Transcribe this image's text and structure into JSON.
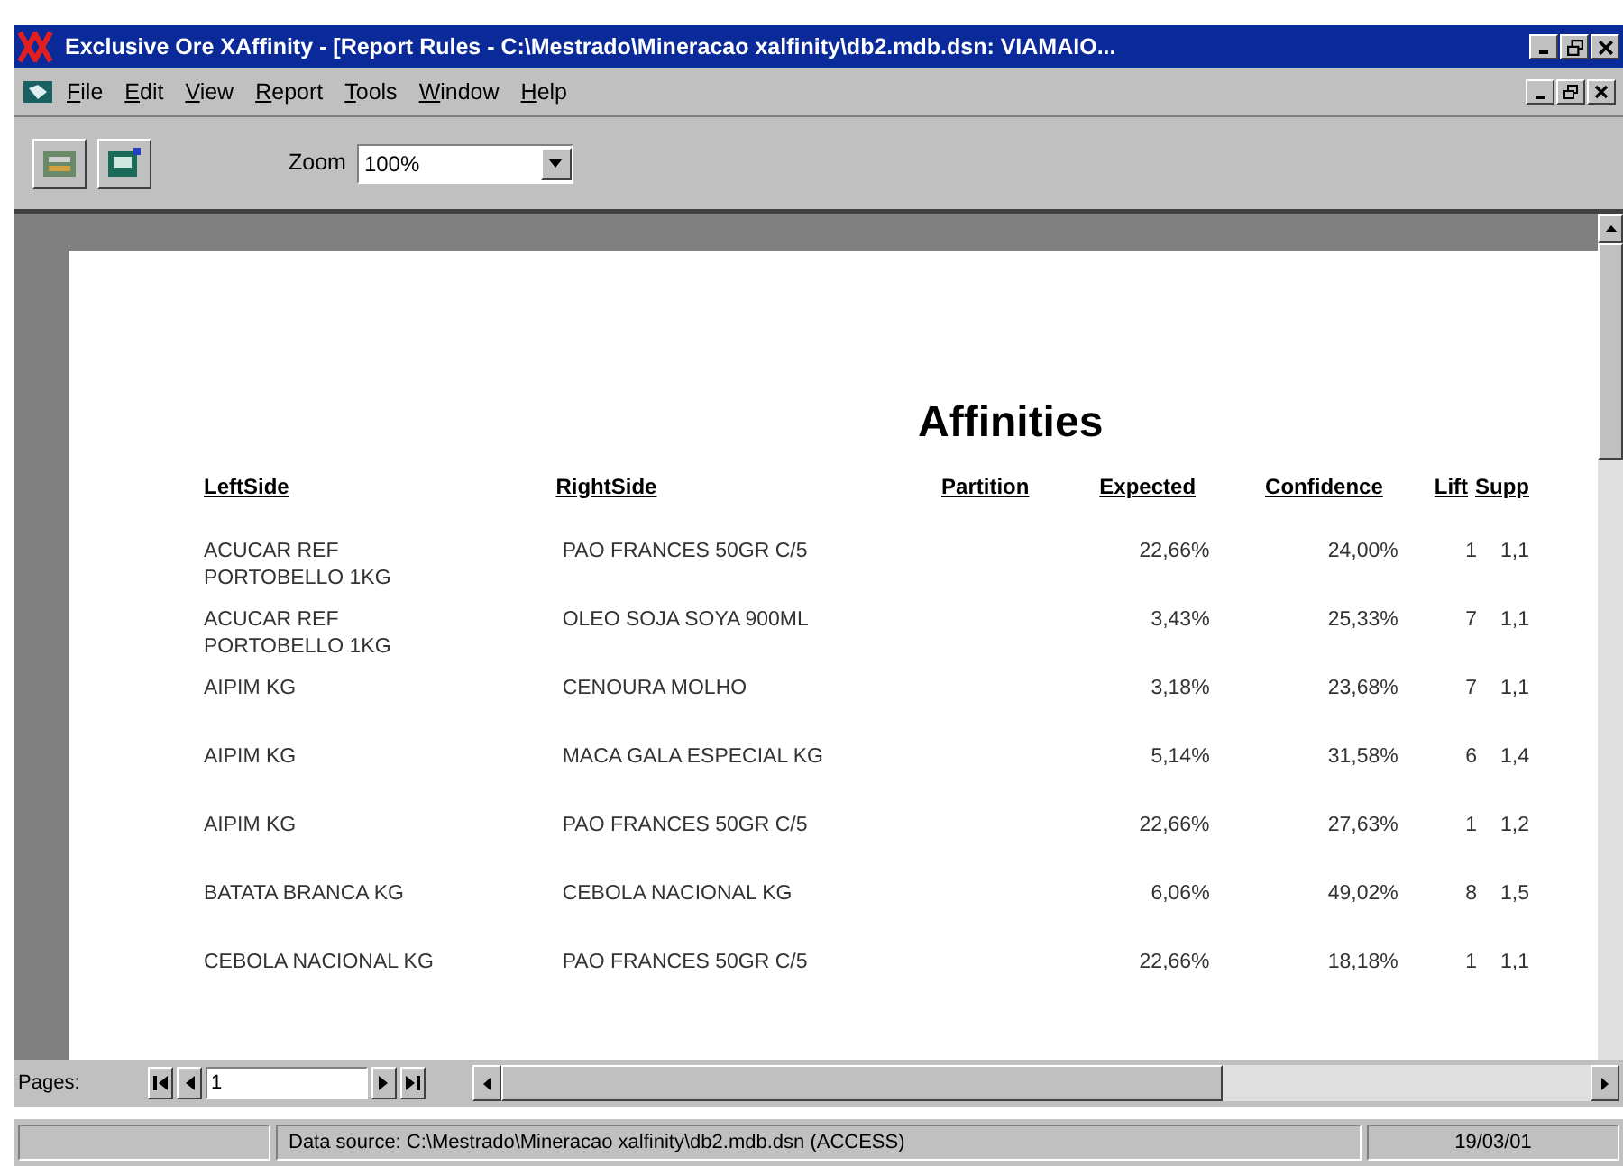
{
  "window": {
    "title": "Exclusive Ore XAffinity - [Report Rules - C:\\Mestrado\\Mineracao xalfinity\\db2.mdb.dsn: VIAMAIO..."
  },
  "menu": [
    {
      "mnemonic": "F",
      "rest": "ile"
    },
    {
      "mnemonic": "E",
      "rest": "dit"
    },
    {
      "mnemonic": "V",
      "rest": "iew"
    },
    {
      "mnemonic": "R",
      "rest": "eport"
    },
    {
      "mnemonic": "T",
      "rest": "ools"
    },
    {
      "mnemonic": "W",
      "rest": "indow"
    },
    {
      "mnemonic": "H",
      "rest": "elp"
    }
  ],
  "toolbar": {
    "zoom_label": "Zoom",
    "zoom_value": "100%"
  },
  "report": {
    "title": "Affinities",
    "columns": [
      "LeftSide",
      "RightSide",
      "Partition",
      "Expected",
      "Confidence",
      "Lift",
      "Supp"
    ],
    "rows": [
      {
        "left": "ACUCAR REF PORTOBELLO 1KG",
        "right": "PAO FRANCES 50GR C/5",
        "expected": "22,66%",
        "confidence": "24,00%",
        "lift": "1",
        "support": "1,1"
      },
      {
        "left": "ACUCAR REF PORTOBELLO 1KG",
        "right": "OLEO SOJA SOYA 900ML",
        "expected": "3,43%",
        "confidence": "25,33%",
        "lift": "7",
        "support": "1,1"
      },
      {
        "left": "AIPIM KG",
        "right": "CENOURA MOLHO",
        "expected": "3,18%",
        "confidence": "23,68%",
        "lift": "7",
        "support": "1,1"
      },
      {
        "left": "AIPIM KG",
        "right": "MACA GALA ESPECIAL KG",
        "expected": "5,14%",
        "confidence": "31,58%",
        "lift": "6",
        "support": "1,4"
      },
      {
        "left": "AIPIM KG",
        "right": "PAO FRANCES 50GR C/5",
        "expected": "22,66%",
        "confidence": "27,63%",
        "lift": "1",
        "support": "1,2"
      },
      {
        "left": "BATATA BRANCA KG",
        "right": "CEBOLA NACIONAL KG",
        "expected": "6,06%",
        "confidence": "49,02%",
        "lift": "8",
        "support": "1,5"
      },
      {
        "left": "CEBOLA NACIONAL KG",
        "right": "PAO FRANCES 50GR C/5",
        "expected": "22,66%",
        "confidence": "18,18%",
        "lift": "1",
        "support": "1,1"
      }
    ]
  },
  "pager": {
    "label": "Pages:",
    "page": "1"
  },
  "status_bar": {
    "source": "Data source: C:\\Mestrado\\Mineracao xalfinity\\db2.mdb.dsn (ACCESS)",
    "date": "19/03/01"
  }
}
